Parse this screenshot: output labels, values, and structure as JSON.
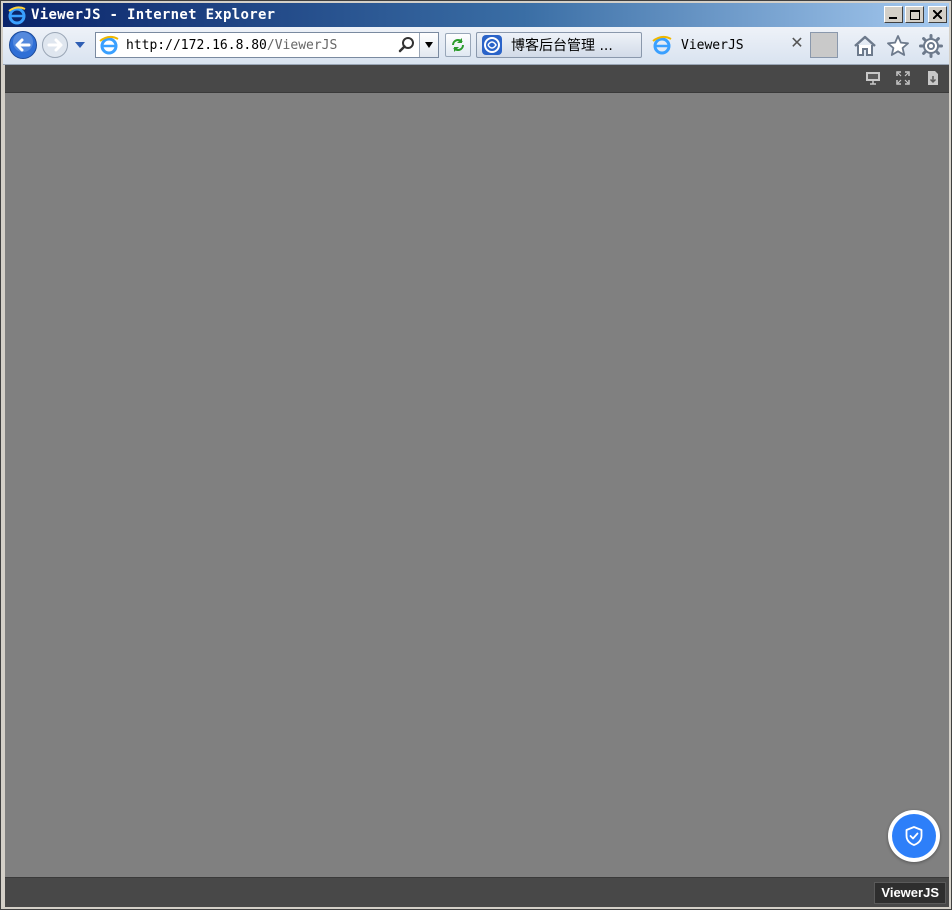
{
  "window": {
    "title": "ViewerJS - Internet Explorer"
  },
  "navbar": {
    "url_host": "http://172.16.8.80",
    "url_path": "/ViewerJS",
    "tabs": [
      {
        "label": "博客后台管理 ...",
        "active": false
      },
      {
        "label": "ViewerJS",
        "active": true
      }
    ]
  },
  "viewer": {
    "toolbar_icons": [
      "presentation-icon",
      "fullscreen-icon",
      "download-icon"
    ],
    "brand_label": "ViewerJS",
    "background": "#808080",
    "bar_color": "#484848",
    "fab_color": "#2d7ff9"
  }
}
